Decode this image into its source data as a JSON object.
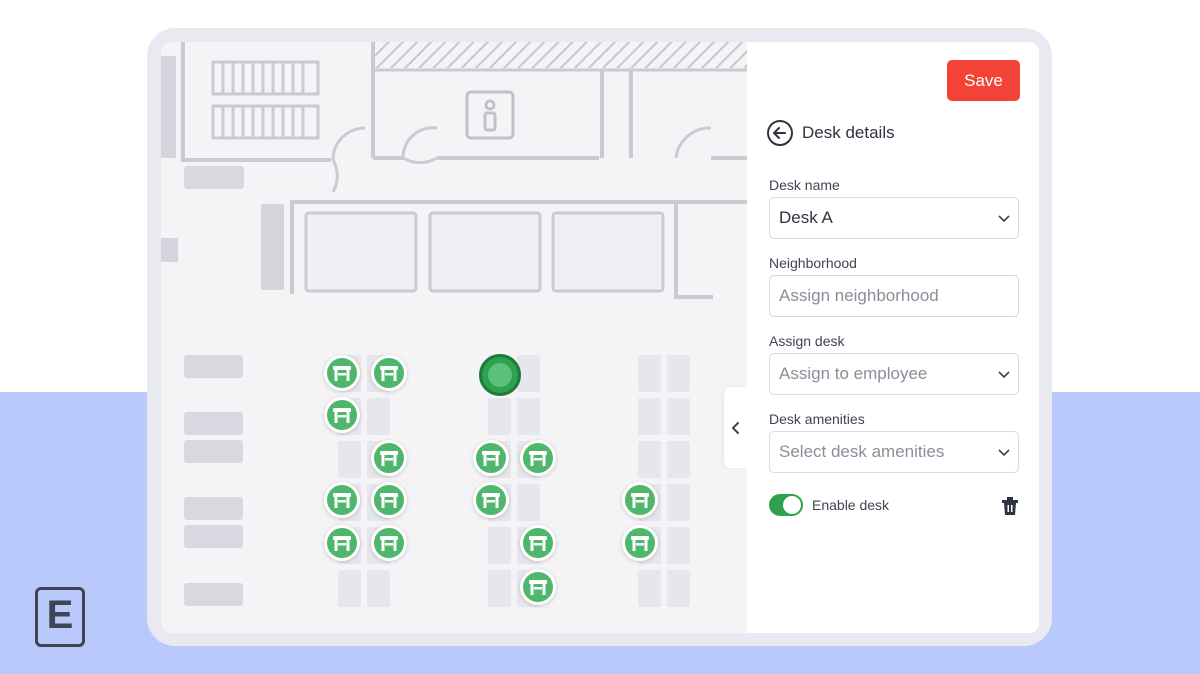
{
  "brand": {
    "logo_letter": "E"
  },
  "colors": {
    "accent": "#2ea14f",
    "save": "#f24336",
    "desk_marker": "#4fb76b",
    "background_band": "#b9c9fb"
  },
  "map": {
    "collapse_icon": "chevron-left-icon",
    "desk_icon": "desk-icon",
    "desk_count": 16,
    "selected_desk_icon": "selected-desk-dot"
  },
  "panel": {
    "save_label": "Save",
    "back_icon": "arrow-left-circle-icon",
    "title": "Desk details",
    "desk_name": {
      "label": "Desk name",
      "value": "Desk A"
    },
    "neighborhood": {
      "label": "Neighborhood",
      "placeholder": "Assign neighborhood"
    },
    "assign_desk": {
      "label": "Assign desk",
      "placeholder": "Assign to employee"
    },
    "amenities": {
      "label": "Desk amenities",
      "placeholder": "Select desk amenities"
    },
    "enable": {
      "label": "Enable desk",
      "on": true
    },
    "delete_icon": "trash-icon"
  }
}
